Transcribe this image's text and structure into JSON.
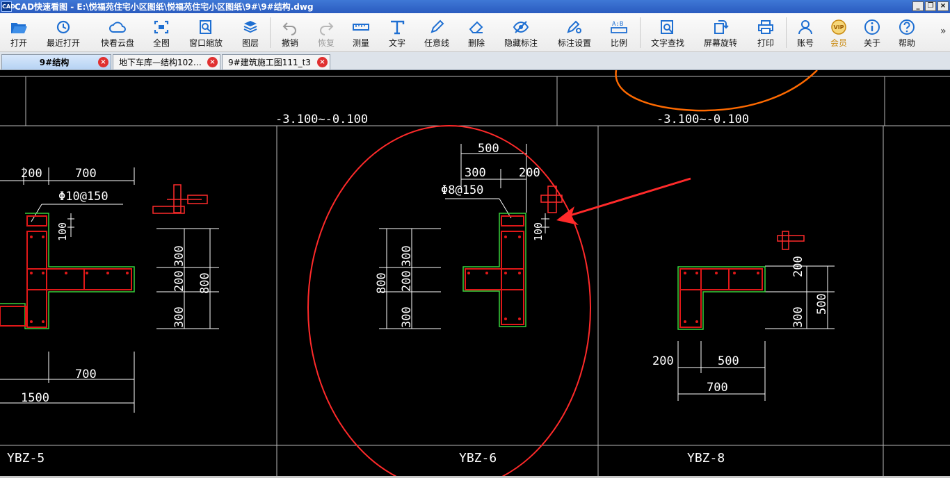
{
  "window": {
    "title": "CAD快速看图 - E:\\悦福苑住宅小区图纸\\悦福苑住宅小区图纸\\9#\\9#结构.dwg",
    "icon_text": "CAD",
    "minimize": "_",
    "restore": "❐",
    "close": "×"
  },
  "toolbar": {
    "open": "打开",
    "recent": "最近打开",
    "cloud": "快看云盘",
    "full": "全图",
    "window_zoom": "窗口缩放",
    "layers": "图层",
    "undo": "撤销",
    "redo": "恢复",
    "measure": "测量",
    "text": "文字",
    "freeline": "任意线",
    "erase": "删除",
    "hide_annot": "隐藏标注",
    "annot_settings": "标注设置",
    "scale": "比例",
    "text_search": "文字查找",
    "rotate": "屏幕旋转",
    "print": "打印",
    "account": "账号",
    "vip": "会员",
    "about": "关于",
    "help": "帮助",
    "more": "»"
  },
  "tabs": [
    {
      "label": "9#结构",
      "close": "×"
    },
    {
      "label": "地下车库—结构102…",
      "close": "×"
    },
    {
      "label": "9#建筑施工图111_t3",
      "close": "×"
    }
  ],
  "drawing": {
    "elev_left": "-3.100~-0.100",
    "elev_right": "-3.100~-0.100",
    "left": {
      "dim_200": "200",
      "dim_700": "700",
      "rebar": "Φ10@150",
      "dim_100": "100",
      "dim_300a": "300",
      "dim_200b": "200",
      "dim_300b": "300",
      "dim_800": "800",
      "dim_700b": "700",
      "dim_1500": "1500",
      "label": "YBZ-5"
    },
    "center": {
      "dim_500": "500",
      "dim_300": "300",
      "dim_200": "200",
      "rebar": "Φ8@150",
      "dim_100": "100",
      "dim_800": "800",
      "dim_300a": "300",
      "dim_200b": "200",
      "dim_300b": "300",
      "label": "YBZ-6"
    },
    "right": {
      "dim_200": "200",
      "dim_300": "300",
      "dim_500": "500",
      "dim_200b": "200",
      "dim_500b": "500",
      "dim_700": "700",
      "label": "YBZ-8"
    }
  },
  "colors": {
    "annotation_red": "#ff2a2a",
    "orange_curve": "#ff6a00",
    "outline_green": "#39d23c",
    "rebar_red": "#e01818",
    "cad_white": "#ffffff",
    "grid_gray": "#b8b8b8"
  }
}
